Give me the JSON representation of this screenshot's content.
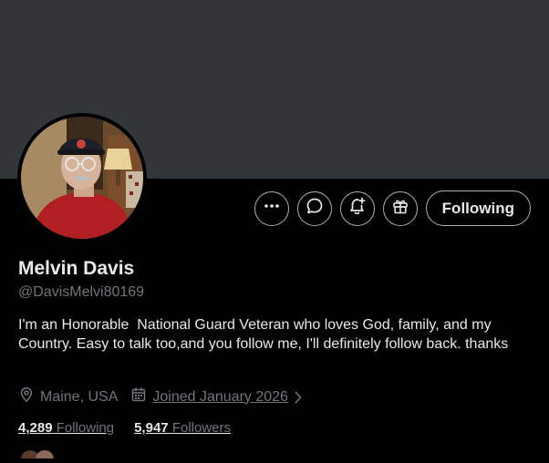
{
  "profile": {
    "name": "Melvin Davis",
    "handle": "@DavisMelvi80169",
    "bio": "I'm an Honorable  National Guard Veteran who loves God, family, and my Country. Easy to talk too,and you follow me, I'll definitely follow back. thanks",
    "location": "Maine, USA",
    "joined": "Joined January 2026"
  },
  "actions": {
    "follow_label": "Following",
    "icons": [
      "more-icon",
      "message-icon",
      "notification-add-icon",
      "gift-icon"
    ]
  },
  "stats": {
    "following_count": "4,289",
    "following_label": "Following",
    "followers_count": "5,947",
    "followers_label": "Followers"
  },
  "colors": {
    "banner": "#333639",
    "background": "#000000",
    "text_primary": "#e7e9ea",
    "text_secondary": "#71767b",
    "button_border": "#a9b1b8"
  }
}
